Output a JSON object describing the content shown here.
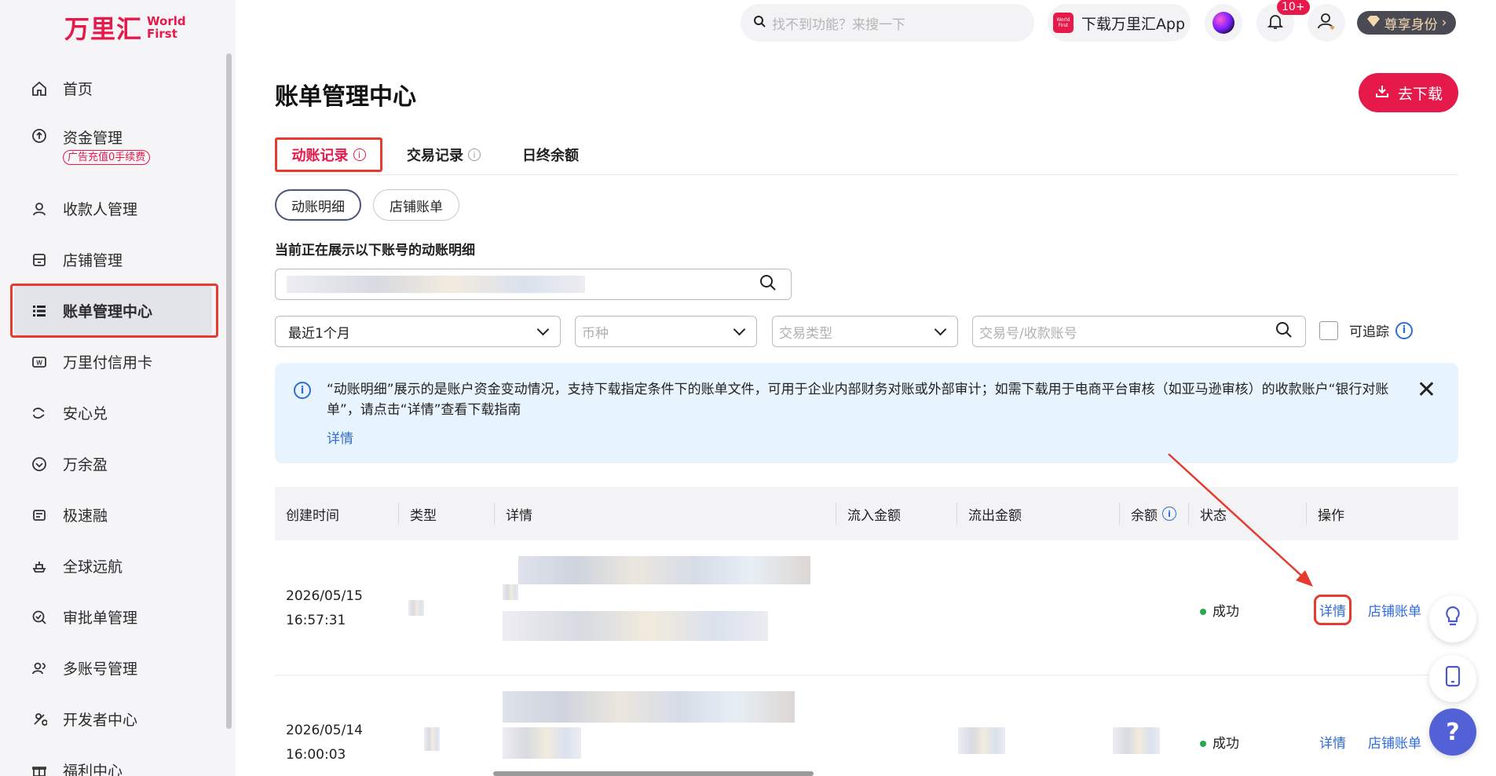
{
  "brand": {
    "name_cn": "万里汇",
    "name_en_1": "World",
    "name_en_2": "First"
  },
  "sidebar": {
    "items": [
      {
        "label": "首页",
        "icon": "home-icon"
      },
      {
        "label": "资金管理",
        "icon": "fund-icon",
        "promo": "广告充值0手续费"
      },
      {
        "label": "收款人管理",
        "icon": "user-icon"
      },
      {
        "label": "店铺管理",
        "icon": "store-icon"
      },
      {
        "label": "账单管理中心",
        "icon": "list-icon",
        "active": true
      },
      {
        "label": "万里付信用卡",
        "icon": "card-icon"
      },
      {
        "label": "安心兑",
        "icon": "exchange-icon"
      },
      {
        "label": "万余盈",
        "icon": "savings-icon"
      },
      {
        "label": "极速融",
        "icon": "finance-icon"
      },
      {
        "label": "全球远航",
        "icon": "ship-icon"
      },
      {
        "label": "审批单管理",
        "icon": "approval-icon"
      },
      {
        "label": "多账号管理",
        "icon": "accounts-icon"
      },
      {
        "label": "开发者中心",
        "icon": "developer-icon"
      },
      {
        "label": "福利中心",
        "icon": "gift-icon"
      }
    ]
  },
  "header": {
    "search_placeholder": "找不到功能？来搜一下",
    "app_download": "下载万里汇App",
    "app_badge": "World First",
    "notif_count": "10+",
    "vip_label": "尊享身份"
  },
  "main": {
    "title": "账单管理中心",
    "download_button": "去下载",
    "tabs": [
      "动账记录",
      "交易记录",
      "日终余额"
    ],
    "subtabs": [
      "动账明细",
      "店铺账单"
    ],
    "account_label": "当前正在展示以下账号的动账明细",
    "account_value": "████████████████",
    "filters": {
      "period": "最近1个月",
      "currency_placeholder": "币种",
      "type_placeholder": "交易类型",
      "search_placeholder": "交易号/收款账号",
      "traceable": "可追踪"
    },
    "notice": {
      "text": "“动账明细”展示的是账户资金变动情况，支持下载指定条件下的账单文件，可用于企业内部财务对账或外部审计；如需下载用于电商平台审核（如亚马逊审核）的收款账户“银行对账单”，请点击“详情”查看下载指南",
      "link": "详情"
    },
    "table": {
      "columns": [
        "创建时间",
        "类型",
        "详情",
        "流入金额",
        "流出金额",
        "余额",
        "状态",
        "操作"
      ],
      "rows": [
        {
          "date": "2026/05/15",
          "time": "16:57:31",
          "status": "成功",
          "action_detail": "详情",
          "action_store": "店铺账单"
        },
        {
          "date": "2026/05/14",
          "time": "16:00:03",
          "status": "成功",
          "action_detail": "详情",
          "action_store": "店铺账单"
        }
      ]
    }
  },
  "colors": {
    "brand": "#e6194b",
    "link": "#2f6bd9",
    "highlight": "#e63c2f",
    "success": "#2aa84a"
  }
}
